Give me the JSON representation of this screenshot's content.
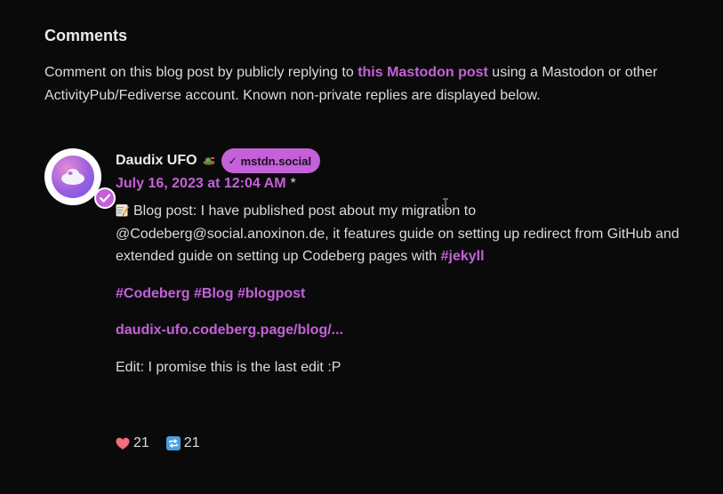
{
  "section": {
    "heading": "Comments"
  },
  "intro": {
    "text_before": "Comment on this blog post by publicly replying to ",
    "link_text": "this Mastodon post",
    "text_after": " using a Mastodon or other ActivityPub/Fediverse account. Known non-private replies are displayed below."
  },
  "comment": {
    "author_name": "Daudix UFO",
    "server_badge": "mstdn.social",
    "date": "July 16, 2023 at 12:04 AM",
    "date_suffix": "*",
    "paragraph1_text": "Blog post: I have published post about my migration to @Codeberg@social.anoxinon.de, it features guide on setting up redirect from GitHub and extended guide on setting up Codeberg pages with ",
    "paragraph1_hashtag": "#jekyll",
    "hashtags": [
      "#Codeberg",
      "#Blog",
      "#blogpost"
    ],
    "link": "daudix-ufo.codeberg.page/blog/...",
    "edit_note": "Edit: I promise this is the last edit :P",
    "likes": "21",
    "boosts": "21"
  },
  "colors": {
    "accent": "#c461d8",
    "background": "#0b0a0b",
    "text": "#dcd9dc",
    "heart": "#f26d7d",
    "boost": "#4a9fe0"
  },
  "icons": {
    "verified": "verified-check-icon",
    "pencil": "pencil-memo-icon",
    "heart": "heart-icon",
    "boost": "boost-repeat-icon",
    "cursor": "text-cursor-icon"
  }
}
